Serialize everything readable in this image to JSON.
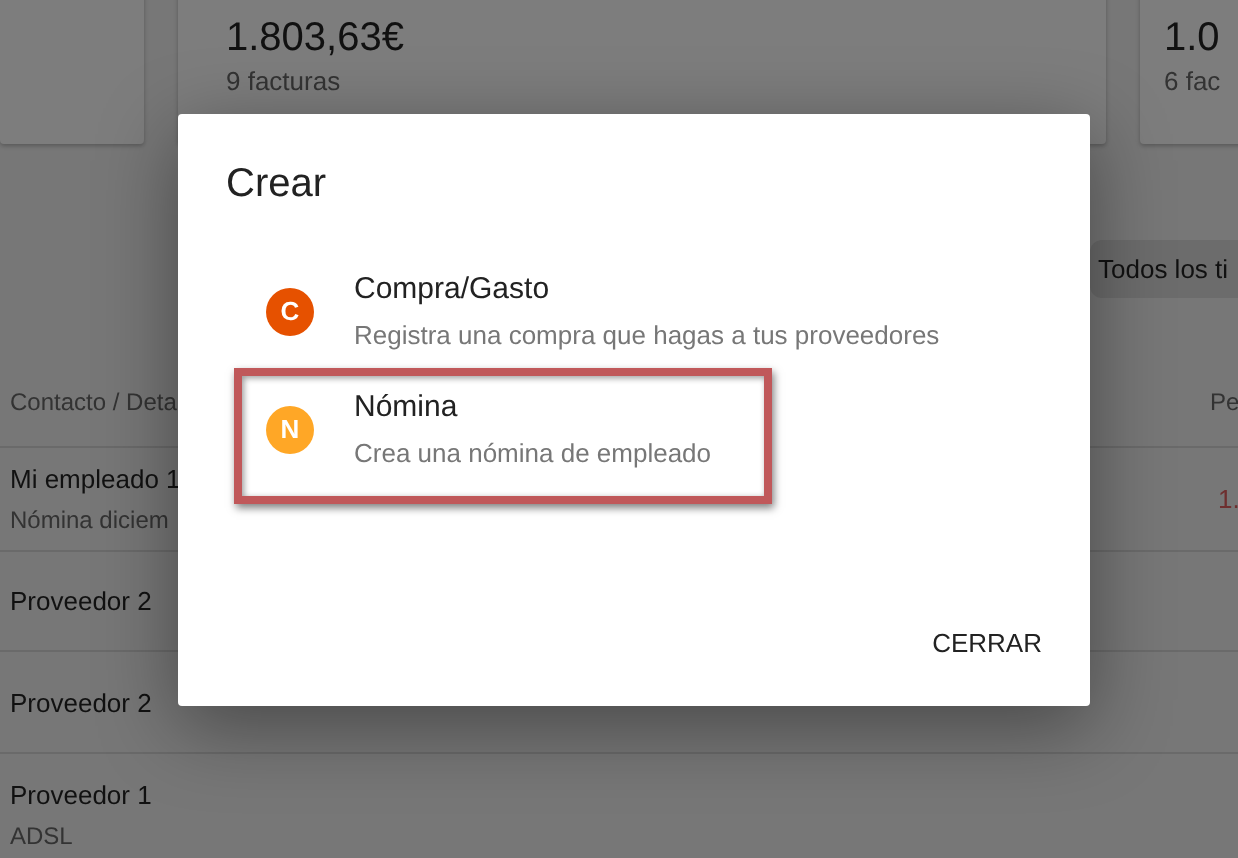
{
  "summary_cards": [
    {
      "amount": "1.803,63€",
      "count": "9 facturas"
    },
    {
      "amount": "1.0",
      "count": "6 fac"
    }
  ],
  "filter_chip": "Todos los ti",
  "table": {
    "columns": [
      "Contacto / Deta",
      "Pe"
    ],
    "rows": [
      {
        "contact": "Mi empleado 1",
        "detail": "Nómina diciem",
        "amount": "1."
      },
      {
        "contact": "Proveedor 2"
      },
      {
        "contact": "Proveedor 2"
      },
      {
        "contact": "Proveedor 1",
        "detail": "ADSL"
      }
    ]
  },
  "dialog": {
    "title": "Crear",
    "options": [
      {
        "letter": "C",
        "title": "Compra/Gasto",
        "description": "Registra una compra que hagas a tus proveedores",
        "color": "#e65100",
        "highlighted": false
      },
      {
        "letter": "N",
        "title": "Nómina",
        "description": "Crea una nómina de empleado",
        "color": "#ffa726",
        "highlighted": true
      }
    ],
    "button": "CERRAR"
  }
}
